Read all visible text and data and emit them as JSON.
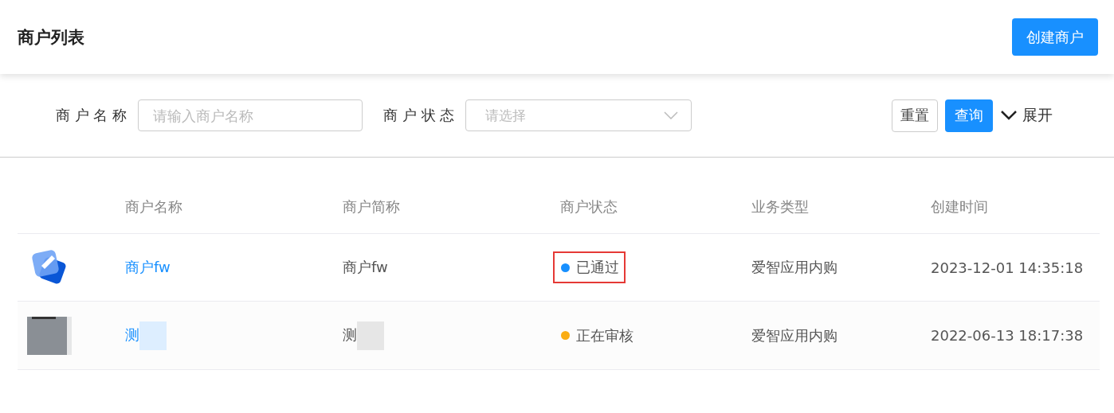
{
  "header": {
    "title": "商户列表",
    "create_button": "创建商户"
  },
  "filters": {
    "fields": [
      {
        "label": "商 户 名 称",
        "kind": "input",
        "placeholder": "请输入商户名称"
      },
      {
        "label": "商 户 状 态",
        "kind": "select",
        "placeholder": "请选择"
      }
    ],
    "reset_button": "重置",
    "search_button": "查询",
    "expand_toggle": "展开"
  },
  "table": {
    "columns": [
      "商户名称",
      "商户简称",
      "商户状态",
      "业务类型",
      "创建时间"
    ],
    "rows": [
      {
        "avatar": {
          "kind": "icon"
        },
        "name": "商户fw",
        "short_name": "商户fw",
        "redacted": false,
        "status": "已通过",
        "color": "#1890ff",
        "highlighted": true,
        "business_type": "爱智应用内购",
        "created": "2023-12-01 14:35:18"
      },
      {
        "name": "测",
        "short_name": "测",
        "redacted": true,
        "status": "正在审核",
        "color": "#faad14",
        "highlighted": false,
        "business_type": "爱智应用内购",
        "created": "2022-06-13 18:17:38"
      }
    ]
  }
}
